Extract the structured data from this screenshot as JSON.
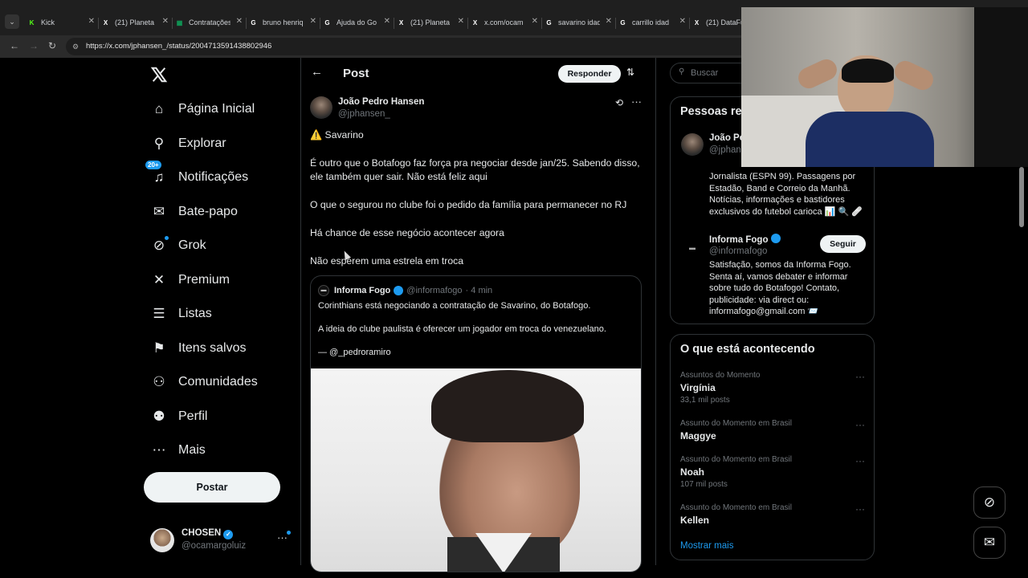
{
  "browser": {
    "tabs": [
      {
        "label": "Kick",
        "icon": "kick-icon",
        "color": "#53fc18"
      },
      {
        "label": "(21) Planeta",
        "icon": "x-icon",
        "color": "#ffffff"
      },
      {
        "label": "Contratações",
        "icon": "sheets-icon",
        "color": "#0f9d58"
      },
      {
        "label": "bruno henriq",
        "icon": "google-icon",
        "color": "#ffffff"
      },
      {
        "label": "Ajuda do Go",
        "icon": "google-g-icon",
        "color": "#ffffff"
      },
      {
        "label": "(21) Planeta",
        "icon": "x-icon",
        "color": "#ffffff"
      },
      {
        "label": "x.com/ocam",
        "icon": "x-icon",
        "color": "#ffffff"
      },
      {
        "label": "savarino idad",
        "icon": "google-icon",
        "color": "#ffffff"
      },
      {
        "label": "carrillo idad",
        "icon": "google-icon",
        "color": "#ffffff"
      },
      {
        "label": "(21) DataFut",
        "icon": "x-icon",
        "color": "#ffffff"
      }
    ],
    "url": "https://x.com/jphansen_/status/2004713591438802946"
  },
  "sidebar": {
    "items": [
      {
        "label": "Página Inicial",
        "icon": "home-icon"
      },
      {
        "label": "Explorar",
        "icon": "search-icon"
      },
      {
        "label": "Notificações",
        "icon": "bell-icon",
        "badge": "20+"
      },
      {
        "label": "Bate-papo",
        "icon": "mail-icon"
      },
      {
        "label": "Grok",
        "icon": "grok-icon"
      },
      {
        "label": "Premium",
        "icon": "x-premium-icon"
      },
      {
        "label": "Listas",
        "icon": "list-icon"
      },
      {
        "label": "Itens salvos",
        "icon": "bookmark-icon"
      },
      {
        "label": "Comunidades",
        "icon": "communities-icon"
      },
      {
        "label": "Perfil",
        "icon": "person-icon"
      },
      {
        "label": "Mais",
        "icon": "more-circle-icon"
      }
    ],
    "post_button": "Postar",
    "account": {
      "name": "CHOSEN",
      "handle": "@ocamargoluiz"
    }
  },
  "post": {
    "header_title": "Post",
    "reply_button": "Responder",
    "author_name": "João Pedro Hansen",
    "author_handle": "@jphansen_",
    "lines": [
      "⚠️ Savarino",
      "É outro que o Botafogo faz força pra negociar desde jan/25. Sabendo disso, ele também quer sair. Não está feliz aqui",
      "O que o segurou no clube foi o pedido da família para permanecer no RJ",
      "Há chance de esse negócio acontecer agora",
      "Não esperem uma estrela em troca"
    ],
    "quote": {
      "name": "Informa Fogo",
      "handle": "@informafogo",
      "time": "· 4 min",
      "lines": [
        "Corinthians está negociando a contratação de Savarino, do Botafogo.",
        "A ideia do clube paulista é oferecer um jogador em troca do venezuelano.",
        "— @_pedroramiro"
      ]
    }
  },
  "right": {
    "search_placeholder": "Buscar",
    "people_title": "Pessoas re",
    "people": [
      {
        "name": "João Pe",
        "handle": "@jphans",
        "bio": "Jornalista (ESPN 99). Passagens por Estadão, Band e Correio da Manhã. Notícias, informações e bastidores exclusivos do futebol carioca 📊 🔍 🩹"
      },
      {
        "name": "Informa Fogo",
        "handle": "@informafogo",
        "follow": "Seguir",
        "bio": "Satisfação, somos da Informa Fogo. Senta aí, vamos debater e informar sobre tudo do Botafogo! Contato, publicidade: via direct ou: informafogo@gmail.com 📨"
      }
    ],
    "trends_title": "O que está acontecendo",
    "trends": [
      {
        "context": "Assuntos do Momento",
        "name": "Virgínia",
        "posts": "33,1 mil posts"
      },
      {
        "context": "Assunto do Momento em Brasil",
        "name": "Maggye",
        "posts": ""
      },
      {
        "context": "Assunto do Momento em Brasil",
        "name": "Noah",
        "posts": "107 mil posts"
      },
      {
        "context": "Assunto do Momento em Brasil",
        "name": "Kellen",
        "posts": ""
      }
    ],
    "show_more": "Mostrar mais"
  }
}
